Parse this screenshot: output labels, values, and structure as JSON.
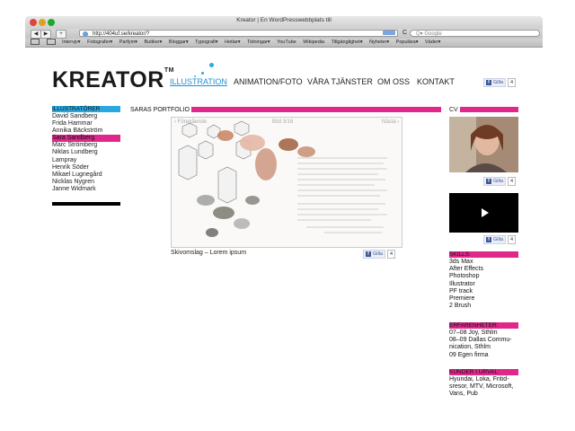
{
  "window": {
    "title": "Kreator | En WordPresswebbplats till"
  },
  "toolbar": {
    "back": "◀",
    "forward": "▶",
    "add": "+",
    "url": "http://404uf.se/kreator/?",
    "reload": "C",
    "search_placeholder": "Q▾ Google"
  },
  "bookmarks": [
    "Intervjv▾",
    "Fotografer▾",
    "Parfym▾",
    "Butiker▾",
    "Bloggar▾",
    "Typografi▾",
    "Hotlar▾",
    "Tidningar▾",
    "YouTube",
    "Wikipedia",
    "Tillgänglighet▾",
    "Nyheter▾",
    "Populära▾",
    "Väder▾"
  ],
  "site": {
    "logo": "KREATOR",
    "logo_tm": "TM",
    "nav": [
      "ILLUSTRATION",
      "ANIMATION/FOTO",
      "VÅRA TJÄNSTER",
      "OM OSS",
      "KONTAKT"
    ],
    "fb": {
      "like": "Gilla",
      "count": "4"
    }
  },
  "illustrators": {
    "heading": "ILLUSTRATÖRER",
    "names": [
      "David Sandberg",
      "Frida Hammar",
      "Annika Bäckström",
      "Sara Sandberg",
      "Marc Strömberg",
      "Niklas Lundberg",
      "Lampray",
      "Henrik Söder",
      "Mikael Lugnegård",
      "Nicklas Nygren",
      "Janne Widmark"
    ],
    "selected_index": 3
  },
  "portfolio": {
    "heading": "SARAS PORTFOLIO",
    "prev": "‹ Föregående",
    "counter": "Bild 3/16",
    "next": "Nästa ›",
    "caption": "Skivomslag – Lorem ipsum"
  },
  "cv": {
    "heading": "CV",
    "skills_heading": "SKILLS:",
    "skills": [
      "3ds Max",
      "After Effects",
      "Photoshop",
      "Illustrator",
      "PF track",
      "Premiere",
      "2 Brush"
    ],
    "experience_heading": "ERFARENHETER:",
    "experience": [
      "07–08 Joy, Sthlm",
      "08–09 Dallas Commu-",
      "nication, Sthlm",
      "09 Egen firma"
    ],
    "clients_heading": "KUNDER I URVAL:",
    "clients": [
      "Hyundai, Loka, Fritid-",
      "sresor, MTV, Microsoft,",
      "Vans, Pub"
    ]
  },
  "colors": {
    "accent_pink": "#e2278b",
    "accent_blue": "#2aa9e0"
  },
  "icons": [
    "play-icon",
    "facebook-icon",
    "globe-icon",
    "rss-icon"
  ]
}
